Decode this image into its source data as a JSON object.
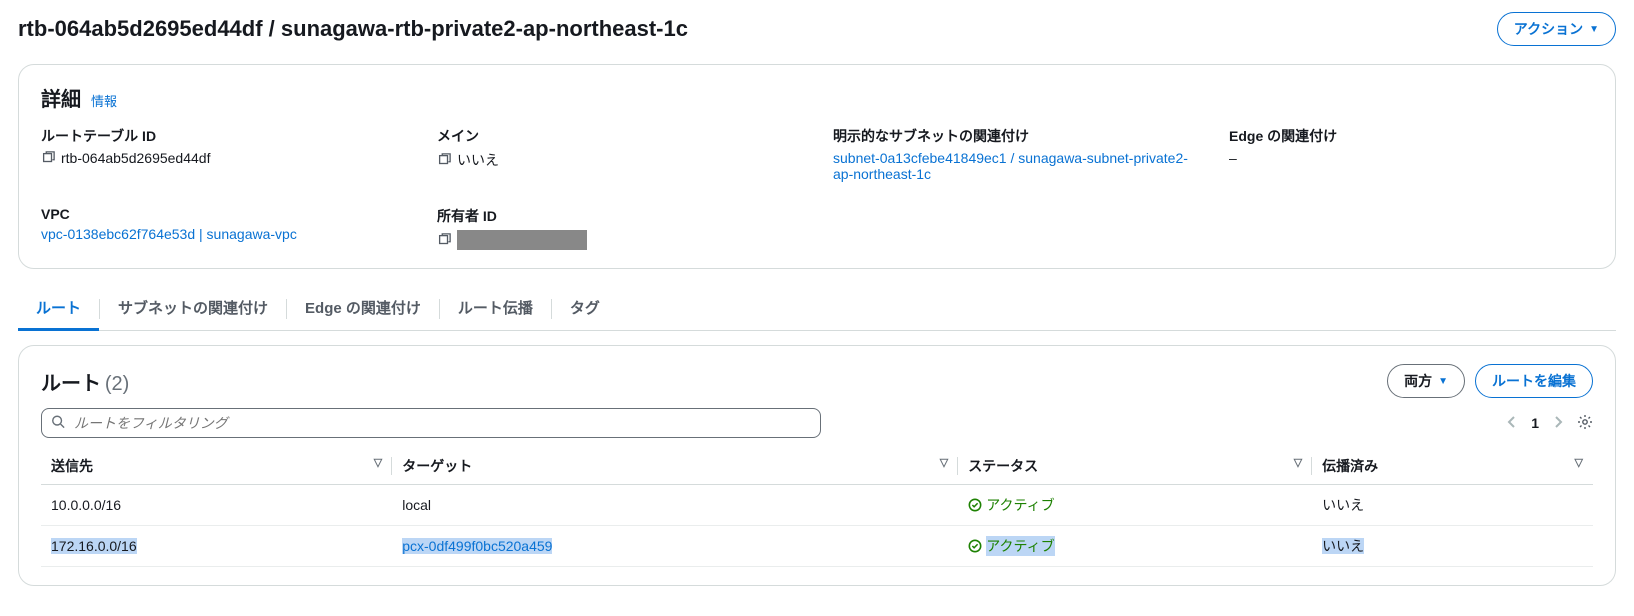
{
  "header": {
    "title": "rtb-064ab5d2695ed44df / sunagawa-rtb-private2-ap-northeast-1c",
    "action_button": "アクション"
  },
  "details": {
    "title": "詳細",
    "info": "情報",
    "fields": {
      "route_table_id": {
        "label": "ルートテーブル ID",
        "value": "rtb-064ab5d2695ed44df"
      },
      "main": {
        "label": "メイン",
        "value": "いいえ"
      },
      "subnet_assoc": {
        "label": "明示的なサブネットの関連付け",
        "value": "subnet-0a13cfebe41849ec1 / sunagawa-subnet-private2-ap-northeast-1c"
      },
      "edge_assoc": {
        "label": "Edge の関連付け",
        "value": "–"
      },
      "vpc": {
        "label": "VPC",
        "value": "vpc-0138ebc62f764e53d | sunagawa-vpc"
      },
      "owner_id": {
        "label": "所有者 ID"
      }
    }
  },
  "tabs": [
    "ルート",
    "サブネットの関連付け",
    "Edge の関連付け",
    "ルート伝播",
    "タグ"
  ],
  "routes": {
    "title": "ルート",
    "count": "(2)",
    "filter_placeholder": "ルートをフィルタリング",
    "dropdown": "両方",
    "edit_button": "ルートを編集",
    "page": "1",
    "columns": {
      "destination": "送信先",
      "target": "ターゲット",
      "status": "ステータス",
      "propagated": "伝播済み"
    },
    "rows": [
      {
        "destination": "10.0.0.0/16",
        "target": "local",
        "target_link": false,
        "status": "アクティブ",
        "propagated": "いいえ",
        "selected": false
      },
      {
        "destination": "172.16.0.0/16",
        "target": "pcx-0df499f0bc520a459",
        "target_link": true,
        "status": "アクティブ",
        "propagated": "いいえ",
        "selected": true
      }
    ]
  }
}
